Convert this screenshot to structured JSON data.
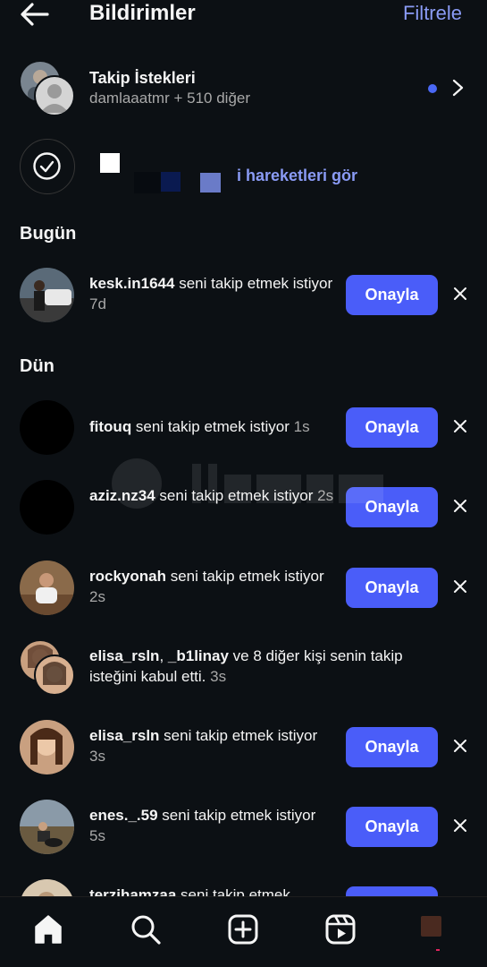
{
  "header": {
    "title": "Bildirimler",
    "filter_label": "Filtrele"
  },
  "requests": {
    "title": "Takip İstekleri",
    "subtitle": "damlaaatmr + 510 diğer"
  },
  "activity": {
    "link_text": "i hareketleri gör"
  },
  "sections": {
    "today": "Bugün",
    "yesterday": "Dün"
  },
  "approve_label": "Onayla",
  "notifications": [
    {
      "user": "kesk.in1644",
      "text": " seni takip etmek istiyor",
      "time": "7d",
      "has_approve": true,
      "avatar_color": "#5a6a78"
    },
    {
      "user": "fitouq",
      "text": " seni takip etmek istiyor",
      "time": "1s",
      "has_approve": true,
      "avatar_color": "#000000"
    },
    {
      "user": "aziz.nz34",
      "text": " seni takip etmek istiyor",
      "time": "2s",
      "has_approve": true,
      "avatar_color": "#000000"
    },
    {
      "user": "rockyonah",
      "text": " seni takip etmek istiyor",
      "time": "2s",
      "has_approve": true,
      "avatar_color": "#8a6a4a"
    },
    {
      "user": "elisa_rsln",
      "user2": "_b1linay",
      "text": " ve 8 diğer kişi senin takip isteğini kabul etti.",
      "time": "3s",
      "has_approve": false,
      "avatar_color": "#c9a080"
    },
    {
      "user": "elisa_rsln",
      "text": " seni takip etmek istiyor",
      "time": "3s",
      "has_approve": true,
      "avatar_color": "#c9a080"
    },
    {
      "user": "enes._.59",
      "text": " seni takip etmek istiyor",
      "time": "5s",
      "has_approve": true,
      "avatar_color": "#7a7060"
    },
    {
      "user": "terzihamzaa",
      "text": " seni takip etmek",
      "time": "",
      "has_approve": true,
      "avatar_color": "#d8c8b0"
    }
  ],
  "colors": {
    "accent": "#4a5df9",
    "link": "#8a9bf5",
    "background": "#0c1014"
  },
  "icons": [
    "back-arrow-icon",
    "chevron-right-icon",
    "check-icon",
    "close-icon",
    "home-icon",
    "search-icon",
    "create-icon",
    "reels-icon",
    "profile-icon"
  ]
}
